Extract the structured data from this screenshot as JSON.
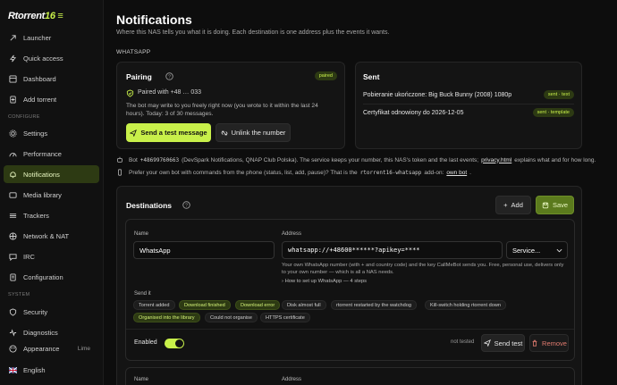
{
  "app": {
    "logo_main": "Rtorrent",
    "logo_accent": "16"
  },
  "sidebar": {
    "items": [
      {
        "label": "Launcher",
        "icon": "launch-icon"
      },
      {
        "label": "Quick access",
        "icon": "lightning-icon"
      },
      {
        "label": "Dashboard",
        "icon": "dashboard-icon"
      },
      {
        "label": "Add torrent",
        "icon": "add-icon"
      }
    ],
    "section_configure": "CONFIGURE",
    "configure_items": [
      {
        "label": "Settings",
        "icon": "gear-icon"
      },
      {
        "label": "Performance",
        "icon": "gauge-icon"
      },
      {
        "label": "Notifications",
        "icon": "bell-icon",
        "active": true
      },
      {
        "label": "Media library",
        "icon": "media-icon"
      },
      {
        "label": "Trackers",
        "icon": "tracker-icon"
      },
      {
        "label": "Network & NAT",
        "icon": "network-icon"
      },
      {
        "label": "IRC",
        "icon": "chat-icon"
      },
      {
        "label": "Configuration",
        "icon": "config-icon"
      }
    ],
    "section_system": "SYSTEM",
    "system_items": [
      {
        "label": "Security",
        "icon": "shield-icon"
      },
      {
        "label": "Diagnostics",
        "icon": "diagnostics-icon"
      },
      {
        "label": "Appearance",
        "icon": "palette-icon",
        "value": "Lime"
      },
      {
        "label": "English",
        "icon": "flag-uk-icon"
      }
    ]
  },
  "page": {
    "title": "Notifications",
    "subtitle": "Where this NAS tells you what it is doing. Each destination is one address plus the events it wants.",
    "section_label": "WHATSAPP"
  },
  "pairing": {
    "title": "Pairing",
    "badge": "paired",
    "paired_with": "Paired with +48 … 033",
    "desc_line1": "The bot may write to you freely right now (you wrote to it within the last 24",
    "desc_line2": "hours). Today: 3 of 30 messages.",
    "send_test_label": "Send a test message",
    "unlink_label": "Unlink the number"
  },
  "sent": {
    "title": "Sent",
    "rows": [
      {
        "text": "Pobieranie ukończone: Big Buck Bunny (2008) 1080p",
        "tag": "sent · text"
      },
      {
        "text": "Certyfikat odnowiony do 2026-12-05",
        "tag": "sent · template"
      }
    ]
  },
  "info": {
    "bot_prefix": "Bot",
    "bot_number": "+48699760663",
    "bot_text": "(DevSpark Notifications, QNAP Club Polska). The service keeps your number, this NAS's token and the last events;",
    "bot_link": "privacy.html",
    "bot_suffix": "explains what and for how long.",
    "own_text": "Prefer your own bot with commands from the phone (status, list, add, pause)? That is the",
    "own_mono": "rtorrent16-whatsapp",
    "own_mid": "add-on:",
    "own_link": "own bot",
    "own_end": "."
  },
  "destinations": {
    "title": "Destinations",
    "add_label": "Add",
    "save_label": "Save",
    "name_label": "Name",
    "name_value": "WhatsApp",
    "address_label": "Address",
    "address_value": "whatsapp://+48600******?apikey=****",
    "service_label": "Service...",
    "hint_line1": "Your own WhatsApp number (with + and country code) and the key CallMeBot sends you. Free, personal use, delivers only",
    "hint_line2": "to your own number — which is all a NAS needs.",
    "howto": "How to set up WhatsApp — 4 steps",
    "send_it_label": "Send it",
    "events": [
      {
        "label": "Torrent added",
        "on": false
      },
      {
        "label": "Download finished",
        "on": true
      },
      {
        "label": "Download error",
        "on": true
      },
      {
        "label": "Disk almost full",
        "on": false
      },
      {
        "label": "rtorrent restarted by the watchdog",
        "on": false
      },
      {
        "label": "Kill-switch holding rtorrent down",
        "on": false
      },
      {
        "label": "Organised into the library",
        "on": true
      },
      {
        "label": "Could not organise",
        "on": false
      },
      {
        "label": "HTTPS certificate",
        "on": false
      }
    ],
    "enabled_label": "Enabled",
    "status": "not tested",
    "send_test_label": "Send test",
    "remove_label": "Remove",
    "name_label_2": "Name",
    "address_label_2": "Address"
  }
}
